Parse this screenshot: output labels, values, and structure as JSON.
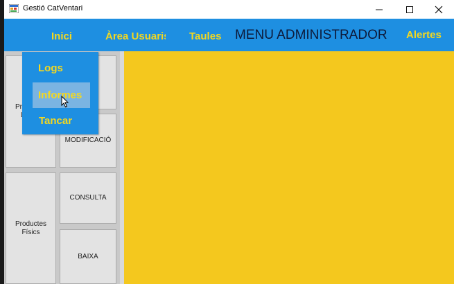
{
  "window": {
    "title": "Gestió CatVentari"
  },
  "menubar": {
    "items": [
      {
        "label": "Inici"
      },
      {
        "label": "Àrea Usuaris"
      },
      {
        "label": "Taules"
      },
      {
        "label": "Alertes"
      }
    ],
    "title": "MENU ADMINISTRADOR"
  },
  "dropdown": {
    "items": [
      {
        "label": "Logs"
      },
      {
        "label": "Informes"
      },
      {
        "label": "Tancar"
      }
    ],
    "highlighted": "Informes"
  },
  "left_panel": {
    "big_tiles": [
      {
        "label": "Productes Lògics"
      },
      {
        "label": "Productes Físics"
      }
    ],
    "small_tiles": [
      {
        "label": ""
      },
      {
        "label": "MODIFICACIÓ"
      },
      {
        "label": "CONSULTA"
      },
      {
        "label": "BAIXA"
      }
    ]
  },
  "colors": {
    "menu_bg": "#1e8fe1",
    "menu_text": "#f5d81e",
    "main_bg": "#f4c81e",
    "highlight": "#7ab4e2"
  }
}
